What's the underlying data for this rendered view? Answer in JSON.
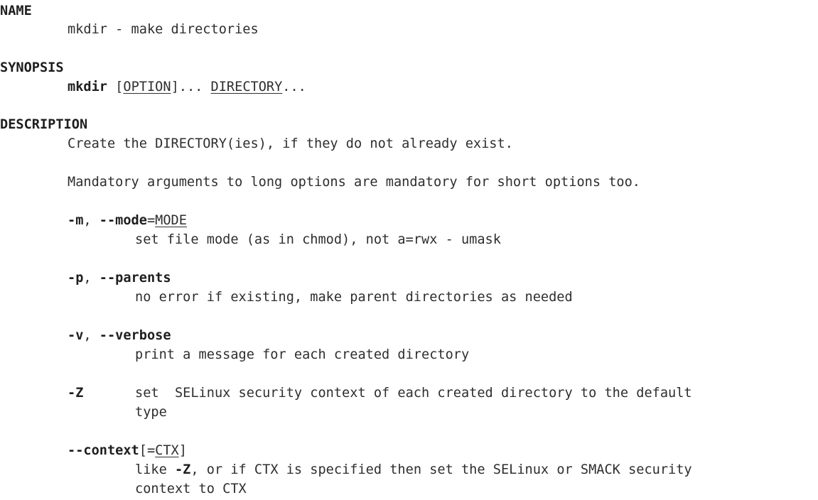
{
  "name_section": {
    "heading": "NAME",
    "text": "mkdir - make directories"
  },
  "synopsis_section": {
    "heading": "SYNOPSIS",
    "command": "mkdir",
    "open_bracket": "[",
    "option": "OPTION",
    "close_bracket": "]...",
    "directory": "DIRECTORY",
    "ellipsis": "..."
  },
  "description_section": {
    "heading": "DESCRIPTION",
    "intro": "Create the DIRECTORY(ies), if they do not already exist.",
    "mandatory": "Mandatory arguments to long options are mandatory for short options too.",
    "options": {
      "mode": {
        "short": "-m",
        "sep": ", ",
        "long": "--mode",
        "eq": "=",
        "arg": "MODE",
        "desc": "set file mode (as in chmod), not a=rwx - umask"
      },
      "parents": {
        "short": "-p",
        "sep": ", ",
        "long": "--parents",
        "desc": "no error if existing, make parent directories as needed"
      },
      "verbose": {
        "short": "-v",
        "sep": ", ",
        "long": "--verbose",
        "desc": "print a message for each created directory"
      },
      "z": {
        "short": "-Z",
        "desc_line1": "set  SELinux security context of each created directory to the default",
        "desc_line2": "type"
      },
      "context": {
        "long": "--context",
        "open": "[=",
        "arg": "CTX",
        "close": "]",
        "desc_prefix": "like ",
        "desc_flag": "-Z",
        "desc_rest": ", or if CTX is specified then set the SELinux or SMACK security",
        "desc_line2": "context to CTX"
      }
    }
  }
}
